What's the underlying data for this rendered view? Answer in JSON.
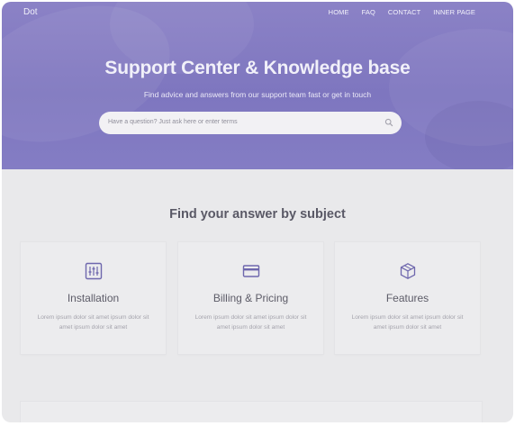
{
  "header": {
    "brand": "Dot",
    "nav": [
      "HOME",
      "FAQ",
      "CONTACT",
      "INNER PAGE"
    ]
  },
  "hero": {
    "title": "Support Center & Knowledge base",
    "subtitle": "Find advice and answers from our support team fast or get in touch",
    "search_placeholder": "Have a question? Just ask here or enter terms"
  },
  "subjects": {
    "title": "Find your answer by subject",
    "cards": [
      {
        "icon": "sliders-icon",
        "title": "Installation",
        "text": "Lorem ipsum dolor sit amet ipsum dolor sit amet ipsum dolor sit amet"
      },
      {
        "icon": "credit-card-icon",
        "title": "Billing & Pricing",
        "text": "Lorem ipsum dolor sit amet ipsum dolor sit amet ipsum dolor sit amet"
      },
      {
        "icon": "box-icon",
        "title": "Features",
        "text": "Lorem ipsum dolor sit amet ipsum dolor sit amet ipsum dolor sit amet"
      }
    ]
  },
  "colors": {
    "hero": "#847dc4",
    "accent_icon": "#6e67ad",
    "page_bg": "#e9e9eb"
  }
}
